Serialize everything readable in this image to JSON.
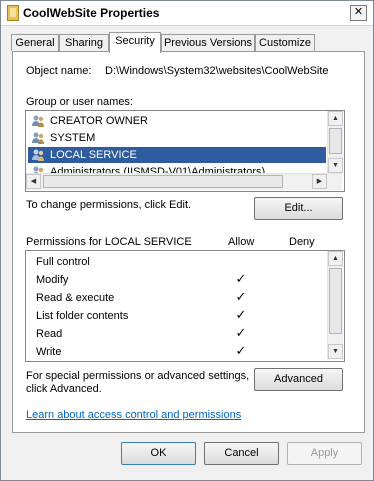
{
  "window": {
    "title": "CoolWebSite Properties",
    "close_glyph": "✕"
  },
  "tabs": [
    {
      "label": "General",
      "active": false
    },
    {
      "label": "Sharing",
      "active": false
    },
    {
      "label": "Security",
      "active": true
    },
    {
      "label": "Previous Versions",
      "active": false
    },
    {
      "label": "Customize",
      "active": false
    }
  ],
  "object": {
    "label": "Object name:",
    "value": "D:\\Windows\\System32\\websites\\CoolWebSite"
  },
  "groups": {
    "label": "Group or user names:",
    "items": [
      {
        "name": "CREATOR OWNER",
        "selected": false
      },
      {
        "name": "SYSTEM",
        "selected": false
      },
      {
        "name": "LOCAL SERVICE",
        "selected": true
      },
      {
        "name": "Administrators (IISMSD-V01\\Administrators)",
        "selected": false
      }
    ]
  },
  "change_hint": "To change permissions, click Edit.",
  "edit_button": "Edit...",
  "permissions": {
    "title": "Permissions for LOCAL SERVICE",
    "allow_header": "Allow",
    "deny_header": "Deny",
    "check_glyph": "✓",
    "rows": [
      {
        "label": "Full control",
        "allow": false,
        "deny": false
      },
      {
        "label": "Modify",
        "allow": true,
        "deny": false
      },
      {
        "label": "Read & execute",
        "allow": true,
        "deny": false
      },
      {
        "label": "List folder contents",
        "allow": true,
        "deny": false
      },
      {
        "label": "Read",
        "allow": true,
        "deny": false
      },
      {
        "label": "Write",
        "allow": true,
        "deny": false
      }
    ]
  },
  "advanced": {
    "hint_line1": "For special permissions or advanced settings,",
    "hint_line2": "click Advanced.",
    "button": "Advanced"
  },
  "learn_link": "Learn about access control and permissions",
  "footer": {
    "ok": "OK",
    "cancel": "Cancel",
    "apply": "Apply"
  }
}
